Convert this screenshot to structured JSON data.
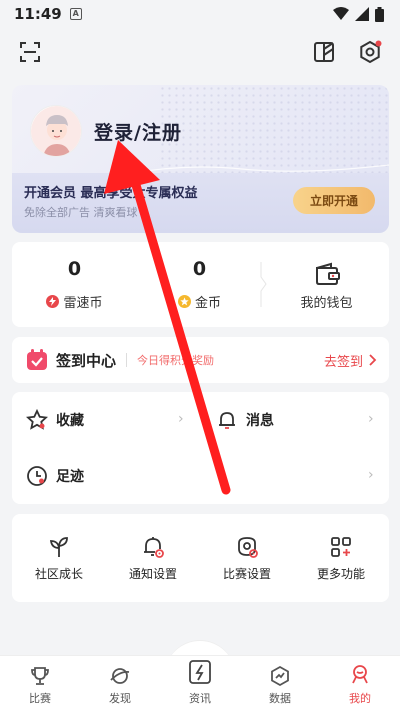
{
  "status_bar": {
    "time": "11:49",
    "badge": "A"
  },
  "top_bar": {
    "scan_icon": "scan-icon",
    "theme_icon": "theme-icon",
    "settings_icon": "settings-icon",
    "badge_color": "#e8474b"
  },
  "member_card": {
    "login_label": "登录/注册",
    "member_title": "开通会员 最高享受大专属权益",
    "member_sub": "免除全部广告 清爽看球",
    "open_button": "立即开通"
  },
  "wallet": {
    "items": [
      {
        "value": "0",
        "label": "雷速币",
        "icon": "leisu-coin-icon"
      },
      {
        "value": "0",
        "label": "金币",
        "icon": "gold-coin-icon"
      },
      {
        "value": "",
        "label": "我的钱包",
        "icon": "wallet-icon"
      }
    ]
  },
  "checkin": {
    "title": "签到中心",
    "hint": "今日得积分奖励",
    "action": "去签到"
  },
  "menu": {
    "favorites": "收藏",
    "messages": "消息",
    "footprints": "足迹"
  },
  "tools": [
    {
      "label": "社区成长",
      "icon": "sprout-icon"
    },
    {
      "label": "通知设置",
      "icon": "bell-settings-icon"
    },
    {
      "label": "比赛设置",
      "icon": "match-settings-icon"
    },
    {
      "label": "更多功能",
      "icon": "more-grid-icon"
    }
  ],
  "tabs": [
    {
      "label": "比赛",
      "icon": "trophy-icon"
    },
    {
      "label": "发现",
      "icon": "planet-icon"
    },
    {
      "label": "资讯",
      "icon": "news-icon"
    },
    {
      "label": "数据",
      "icon": "data-icon"
    },
    {
      "label": "我的",
      "icon": "profile-icon",
      "active": true
    }
  ],
  "colors": {
    "accent": "#e8474b",
    "gold": "#f2b96c",
    "member_bg": "#e6e7f5"
  }
}
